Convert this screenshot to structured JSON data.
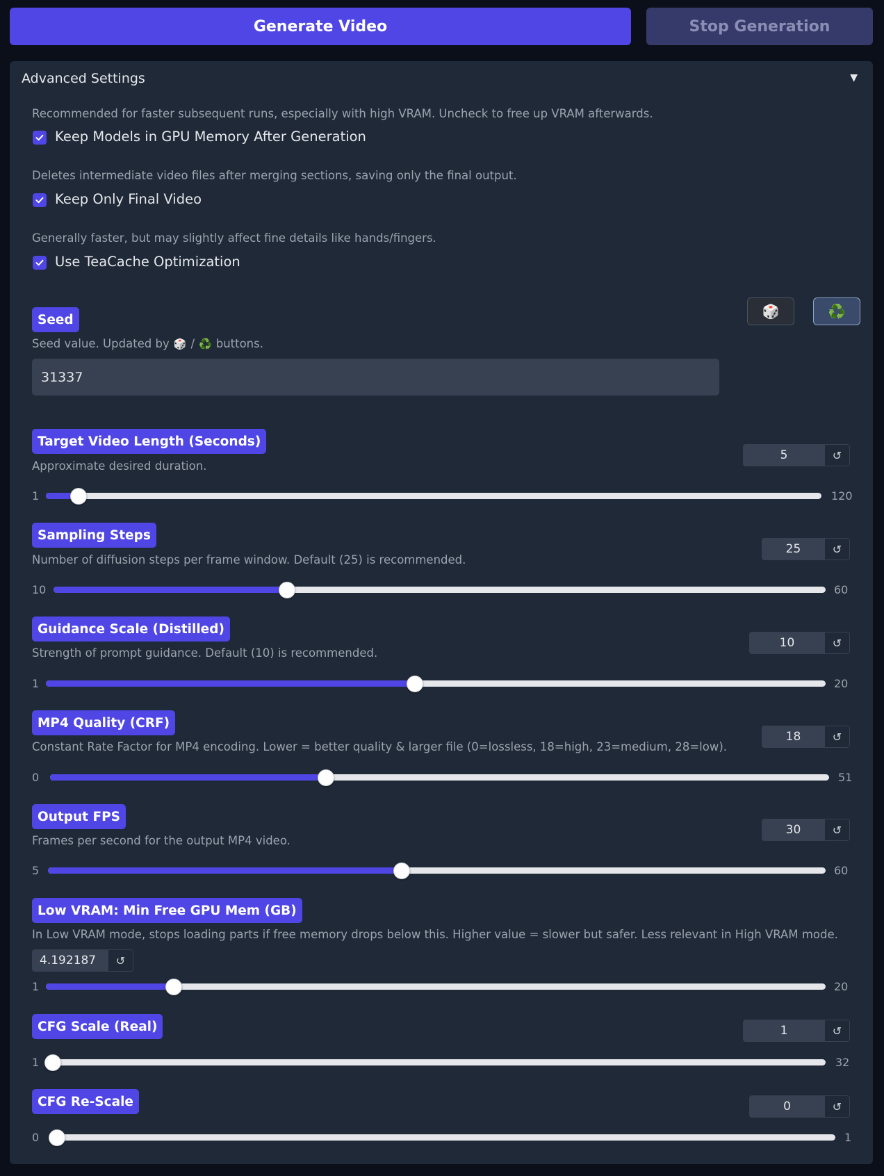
{
  "buttons": {
    "generate": "Generate Video",
    "stop": "Stop Generation"
  },
  "accordion": {
    "title": "Advanced Settings",
    "caret": "▼"
  },
  "checkboxes": [
    {
      "info": "Recommended for faster subsequent runs, especially with high VRAM. Uncheck to free up VRAM afterwards.",
      "label": "Keep Models in GPU Memory After Generation",
      "checked": true
    },
    {
      "info": "Deletes intermediate video files after merging sections, saving only the final output.",
      "label": "Keep Only Final Video",
      "checked": true
    },
    {
      "info": "Generally faster, but may slightly affect fine details like hands/fingers.",
      "label": "Use TeaCache Optimization",
      "checked": true
    }
  ],
  "seed": {
    "label": "Seed",
    "info_prefix": "Seed value. Updated by",
    "info_sep": "/",
    "info_suffix": "buttons.",
    "value": "31337",
    "dice_icon": "🎲",
    "recycle_icon": "♻️"
  },
  "sliders": [
    {
      "key": "length",
      "label": "Target Video Length (Seconds)",
      "info": "Approximate desired duration.",
      "value": "5",
      "min": "1",
      "max": "120",
      "reset": "↺"
    },
    {
      "key": "steps",
      "label": "Sampling Steps",
      "info": "Number of diffusion steps per frame window. Default (25) is recommended.",
      "value": "25",
      "min": "10",
      "max": "60",
      "reset": "↺"
    },
    {
      "key": "gs",
      "label": "Guidance Scale (Distilled)",
      "info": "Strength of prompt guidance. Default (10) is recommended.",
      "value": "10",
      "min": "1",
      "max": "20",
      "reset": "↺"
    },
    {
      "key": "crf",
      "label": "MP4 Quality (CRF)",
      "info": "Constant Rate Factor for MP4 encoding. Lower = better quality & larger file (0=lossless, 18=high, 23=medium, 28=low).",
      "value": "18",
      "min": "0",
      "max": "51",
      "reset": "↺"
    },
    {
      "key": "fps",
      "label": "Output FPS",
      "info": "Frames per second for the output MP4 video.",
      "value": "30",
      "min": "5",
      "max": "60",
      "reset": "↺"
    },
    {
      "key": "vram",
      "label": "Low VRAM: Min Free GPU Mem (GB)",
      "info": "In Low VRAM mode, stops loading parts if free memory drops below this. Higher value = slower but safer. Less relevant in High VRAM mode.",
      "value": "4.192187",
      "min": "1",
      "max": "20",
      "reset": "↺"
    },
    {
      "key": "cfg",
      "label": "CFG Scale (Real)",
      "value": "1",
      "min": "1",
      "max": "32",
      "reset": "↺"
    },
    {
      "key": "rescale",
      "label": "CFG Re-Scale",
      "value": "0",
      "min": "0",
      "max": "1",
      "reset": "↺"
    }
  ],
  "colors": {
    "accent": "#4f46e5",
    "panel": "#1f2937",
    "background": "#0b0f19"
  }
}
